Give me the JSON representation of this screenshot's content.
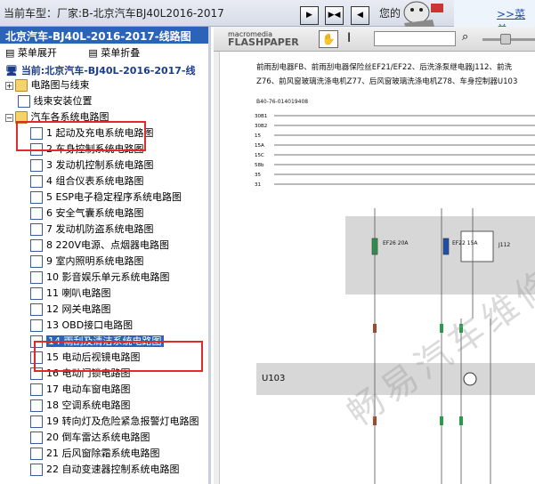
{
  "topbar": {
    "title": "当前车型：厂家:B-北京汽车BJ40L2016-2017",
    "hint": "您的",
    "menu_link": ">>菜单"
  },
  "left": {
    "header": "北京汽车-BJ40L-2016-2017-线路图",
    "expand_all": "菜单展开",
    "collapse_all": "菜单折叠",
    "root": "当前:北京汽车-BJ40L-2016-2017-线",
    "folders": [
      "电路图与线束",
      "线束安装位置",
      "汽车各系统电路图"
    ],
    "items": [
      "1  起动及充电系统电路图",
      "2  车身控制系统电路图",
      "3  发动机控制系统电路图",
      "4  组合仪表系统电路图",
      "5  ESP电子稳定程序系统电路图",
      "6  安全气囊系统电路图",
      "7  发动机防盗系统电路图",
      "8  220V电源、点烟器电路图",
      "9  室内照明系统电路图",
      "10  影音娱乐单元系统电路图",
      "11  喇叭电路图",
      "12  网关电路图",
      "13  OBD接口电路图",
      "14  雨刮及清洁系统电路图",
      "15  电动后视镜电路图",
      "16  电动门锁电路图",
      "17  电动车窗电路图",
      "18  空调系统电路图",
      "19  转向灯及危险紧急报警灯电路图",
      "20  倒车雷达系统电路图",
      "21  后风窗除霜系统电路图",
      "22  自动变速器控制系统电路图"
    ],
    "selected_index": 13
  },
  "viewer": {
    "logo_line1": "macromedia",
    "logo_line2": "FLASHPAPER",
    "heading1": "前雨刮电器FB、前雨刮电器保险丝EF21/EF22、后洗涤泵继电器J112、前洗",
    "heading2": "Z76、前风窗玻璃洗涤电机Z77、后风窗玻璃洗涤电机Z78、车身控制器U103",
    "doc_id": "B40-76-014019408",
    "buses": [
      "30B1",
      "30B2",
      "15",
      "15A",
      "15C",
      "58b",
      "35",
      "31"
    ],
    "fuse1": "EF26 20A",
    "fuse2": "EF22 15A",
    "relay": "J112",
    "module": "U103",
    "watermark": "畅易汽车维修"
  },
  "colors": {
    "accent": "#2a63b7",
    "highlight": "#e12a2a"
  }
}
